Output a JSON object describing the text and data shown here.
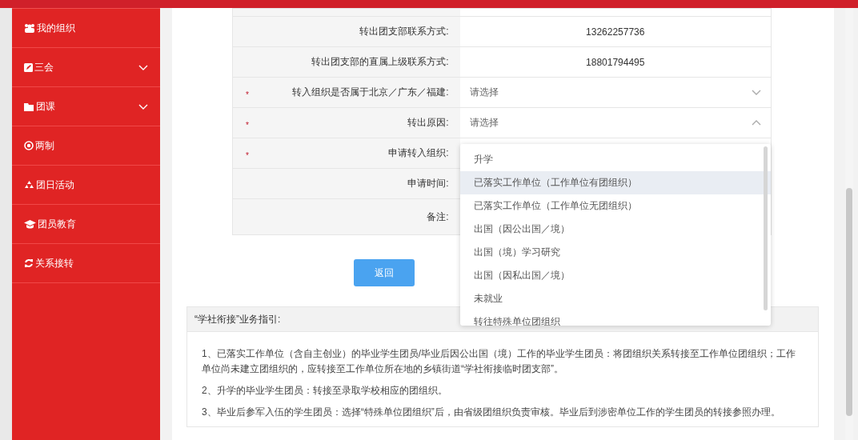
{
  "sidebar": {
    "items": [
      {
        "label": "我的组织",
        "kind": "link"
      },
      {
        "label": "三会",
        "kind": "group"
      },
      {
        "label": "团课",
        "kind": "group"
      },
      {
        "label": "两制",
        "kind": "link"
      },
      {
        "label": "团日活动",
        "kind": "link"
      },
      {
        "label": "团员教育",
        "kind": "link"
      },
      {
        "label": "关系接转",
        "kind": "link"
      }
    ]
  },
  "form": {
    "rows": [
      {
        "label": "转出团支部联系方式:",
        "kind": "text",
        "value": "13262257736"
      },
      {
        "label": "转出团支部的直属上级联系方式:",
        "kind": "text",
        "value": "18801794495"
      },
      {
        "label": "转入组织是否属于北京／广东／福建:",
        "required_mark": "*",
        "kind": "select",
        "placeholder": "请选择",
        "open": false
      },
      {
        "label": "转出原因:",
        "required_mark": "*",
        "kind": "select",
        "placeholder": "请选择",
        "open": true
      },
      {
        "label": "申请转入组织:",
        "required_mark": "*",
        "kind": "blank"
      },
      {
        "label": "申请时间:",
        "kind": "blank"
      },
      {
        "label": "备注:",
        "kind": "blank"
      }
    ]
  },
  "back_button": "返回",
  "dropdown": {
    "options": [
      {
        "label": "升学",
        "highlighted": false
      },
      {
        "label": "已落实工作单位（工作单位有团组织）",
        "highlighted": true
      },
      {
        "label": "已落实工作单位（工作单位无团组织）",
        "highlighted": false
      },
      {
        "label": "出国（因公出国／境）",
        "highlighted": false
      },
      {
        "label": "出国（境）学习研究",
        "highlighted": false
      },
      {
        "label": "出国（因私出国／境）",
        "highlighted": false
      },
      {
        "label": "未就业",
        "highlighted": false
      },
      {
        "label": "转往特殊单位团组织",
        "highlighted": false
      }
    ]
  },
  "guide": {
    "title": "“学社衔接”业务指引:",
    "paragraphs": [
      "1、已落实工作单位（含自主创业）的毕业学生团员/毕业后因公出国（境）工作的毕业学生团员：将团组织关系转接至工作单位团组织；工作单位尚未建立团组织的，应转接至工作单位所在地的乡镇街道“学社衔接临时团支部”。",
      "2、升学的毕业学生团员：转接至录取学校相应的团组织。",
      "3、毕业后参军入伍的学生团员：选择“特殊单位团组织”后，由省级团组织负责审核。毕业后到涉密单位工作的学生团员的转接参照办理。"
    ]
  }
}
